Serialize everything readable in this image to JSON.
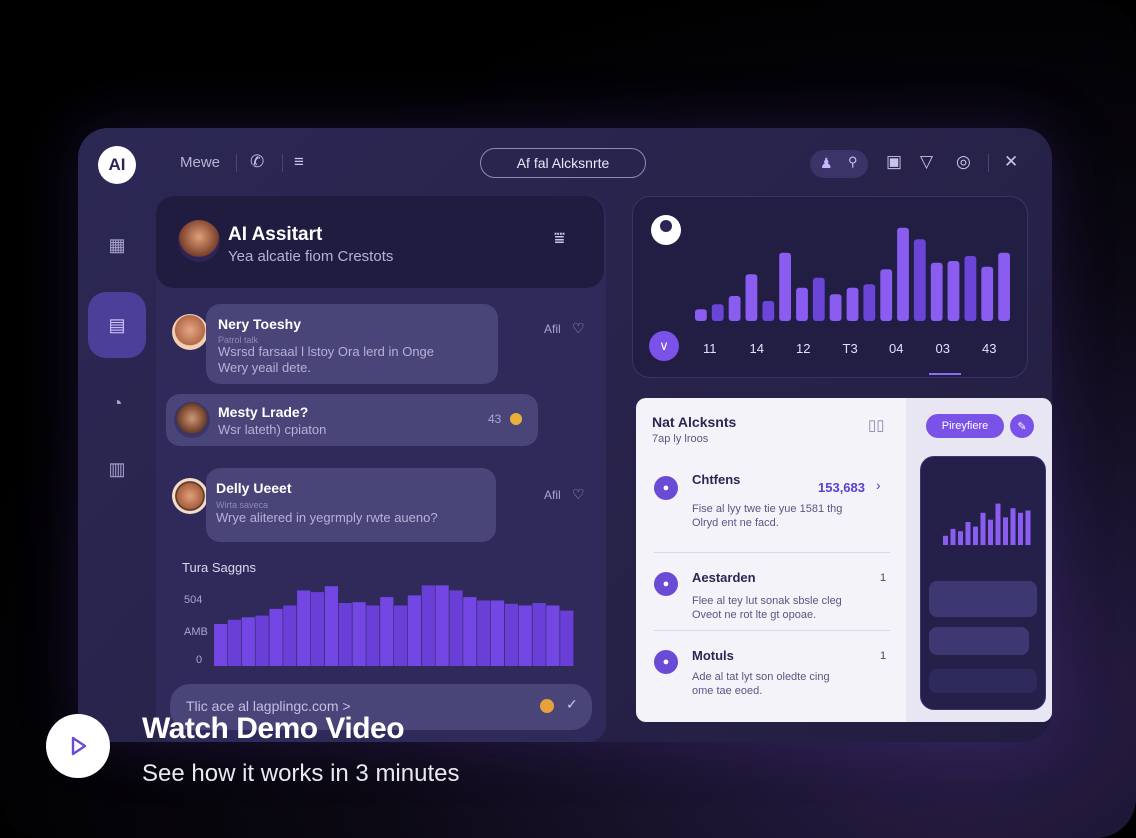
{
  "app": {
    "logo": "AI",
    "nav_label": "Mewe",
    "title_pill": "Af fal Alcksnrte"
  },
  "assistant": {
    "name": "AI Assitart",
    "subtitle": "Yea alcatie fiom Crestots"
  },
  "messages": [
    {
      "name": "Nery Toeshy",
      "handle": "Patrol talk",
      "text": [
        "Wsrsd farsaal l lstoy Ora lerd in Onge",
        "Wery yeail dete."
      ],
      "time": "Afil"
    },
    {
      "name": "Mesty Lrade?",
      "handle": "",
      "text": [
        "Wsr lateth) cpiaton"
      ],
      "time": "43"
    },
    {
      "name": "Delly Ueeet",
      "handle": "Wirta saveca",
      "text": [
        "Wrye alitered in yegrmply rwte aueno?"
      ],
      "time": "Afil"
    }
  ],
  "mini_chart": {
    "title": "Tura Saggns",
    "y_labels": [
      "504",
      "AMB",
      "0"
    ]
  },
  "input": {
    "placeholder": "Tlic ace al lagplingc.com >"
  },
  "chart_data": {
    "type": "bar",
    "categories": [
      "11",
      "14",
      "12",
      "T3",
      "04",
      "03",
      "43"
    ],
    "values": [
      14,
      20,
      30,
      56,
      24,
      82,
      40,
      52,
      32,
      40,
      44,
      62,
      112,
      98,
      70,
      72,
      78,
      65,
      82
    ],
    "xlabel": "",
    "ylabel": ""
  },
  "mini_bars": [
    0.5,
    0.55,
    0.58,
    0.6,
    0.68,
    0.72,
    0.9,
    0.88,
    0.95,
    0.75,
    0.76,
    0.72,
    0.82,
    0.72,
    0.84,
    0.96,
    0.96,
    0.9,
    0.82,
    0.78,
    0.78,
    0.74,
    0.72,
    0.75,
    0.72,
    0.66
  ],
  "panel": {
    "title": "Nat Alcksnts",
    "subtitle": "7ap ly lroos",
    "button": "Pireyfiere",
    "items": [
      {
        "title": "Chtfens",
        "value": "153,683",
        "text": [
          "Fise al lyy twe tie yue 1581 thg",
          "Olryd ent ne facd."
        ]
      },
      {
        "title": "Aestarden",
        "value": "1",
        "text": [
          "Flee al tey lut sonak sbsle cleg",
          "Oveot ne rot lte gt opoae."
        ]
      },
      {
        "title": "Motuls",
        "value": "1",
        "text": [
          "Ade al tat lyt son oledte cing",
          "ome tae eoed."
        ]
      }
    ]
  },
  "demo": {
    "title": "Watch Demo Video",
    "subtitle": "See how it works in 3 minutes"
  }
}
